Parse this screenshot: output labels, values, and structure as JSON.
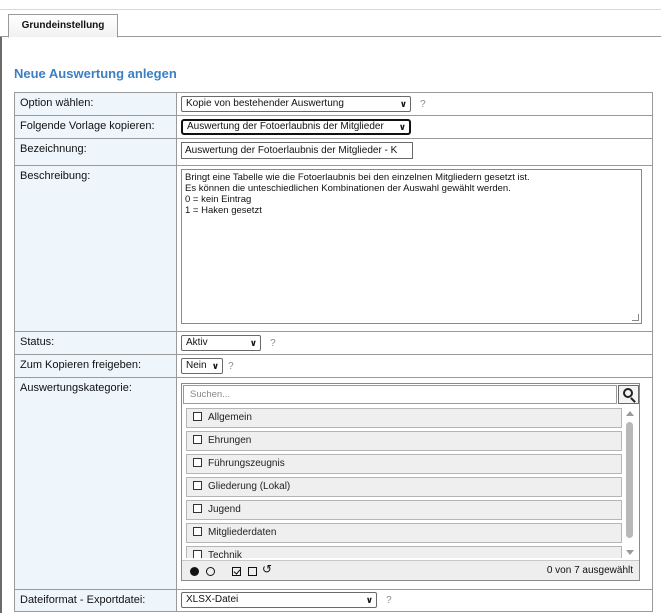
{
  "tabs": [
    {
      "label": "Grundeinstellung"
    }
  ],
  "page_title": "Neue Auswertung anlegen",
  "help_mark": "?",
  "form": {
    "option": {
      "label": "Option wählen:",
      "value": "Kopie von bestehender Auswertung"
    },
    "vorlage": {
      "label": "Folgende Vorlage kopieren:",
      "value": "Auswertung der Fotoerlaubnis der Mitglieder"
    },
    "bezeichnung": {
      "label": "Bezeichnung:",
      "value": "Auswertung der Fotoerlaubnis der Mitglieder - K"
    },
    "beschreibung": {
      "label": "Beschreibung:",
      "value": "Bringt eine Tabelle wie die Fotoerlaubnis bei den einzelnen Mitgliedern gesetzt ist.\nEs können die unteschiedlichen Kombinationen der Auswahl gewählt werden.\n0 = kein Eintrag\n1 = Haken gesetzt"
    },
    "status": {
      "label": "Status:",
      "value": "Aktiv"
    },
    "kopieren": {
      "label": "Zum Kopieren freigeben:",
      "value": "Nein"
    },
    "kategorie": {
      "label": "Auswertungskategorie:",
      "search_placeholder": "Suchen...",
      "items": [
        {
          "label": "Allgemein"
        },
        {
          "label": "Ehrungen"
        },
        {
          "label": "Führungszeugnis"
        },
        {
          "label": "Gliederung (Lokal)"
        },
        {
          "label": "Jugend"
        },
        {
          "label": "Mitgliederdaten"
        },
        {
          "label": "Technik"
        }
      ],
      "count_text": "0 von 7 ausgewählt"
    },
    "dateiformat": {
      "label": "Dateiformat - Exportdatei:",
      "value": "XLSX-Datei"
    }
  }
}
